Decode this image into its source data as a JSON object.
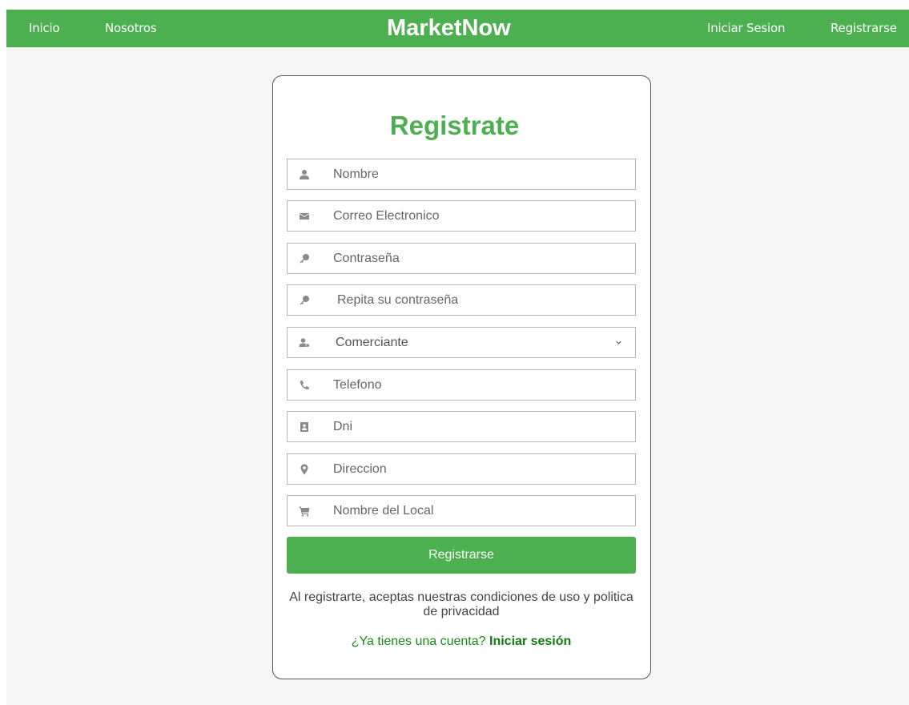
{
  "nav": {
    "brand": "MarketNow",
    "links_left": [
      "Inicio",
      "Nosotros"
    ],
    "links_right": [
      "Iniciar Sesion",
      "Registrarse"
    ]
  },
  "colors": {
    "accent": "#4caf50",
    "link_dark": "#117a11",
    "background": "#f6f6f6"
  },
  "form": {
    "title": "Registrate",
    "fields": [
      {
        "placeholder": "Nombre",
        "icon": "user-icon"
      },
      {
        "placeholder": "Correo Electronico",
        "icon": "envelope-icon"
      },
      {
        "placeholder": "Contraseña",
        "icon": "key-icon"
      },
      {
        "placeholder": "Repita su contraseña",
        "icon": "key-icon"
      },
      {
        "select_value": "Comerciante",
        "icon": "user-tag-icon"
      },
      {
        "placeholder": "Telefono",
        "icon": "phone-icon"
      },
      {
        "placeholder": "Dni",
        "icon": "id-card-icon"
      },
      {
        "placeholder": "Direccion",
        "icon": "map-marker-icon"
      },
      {
        "placeholder": "Nombre del Local",
        "icon": "cart-icon"
      }
    ],
    "submit_label": "Registrarse",
    "terms_text": "Al registrarte, aceptas nuestras condiciones de uso y politica de privacidad",
    "have_account_text": "¿Ya tienes una cuenta?",
    "login_link": "Iniciar sesión"
  }
}
